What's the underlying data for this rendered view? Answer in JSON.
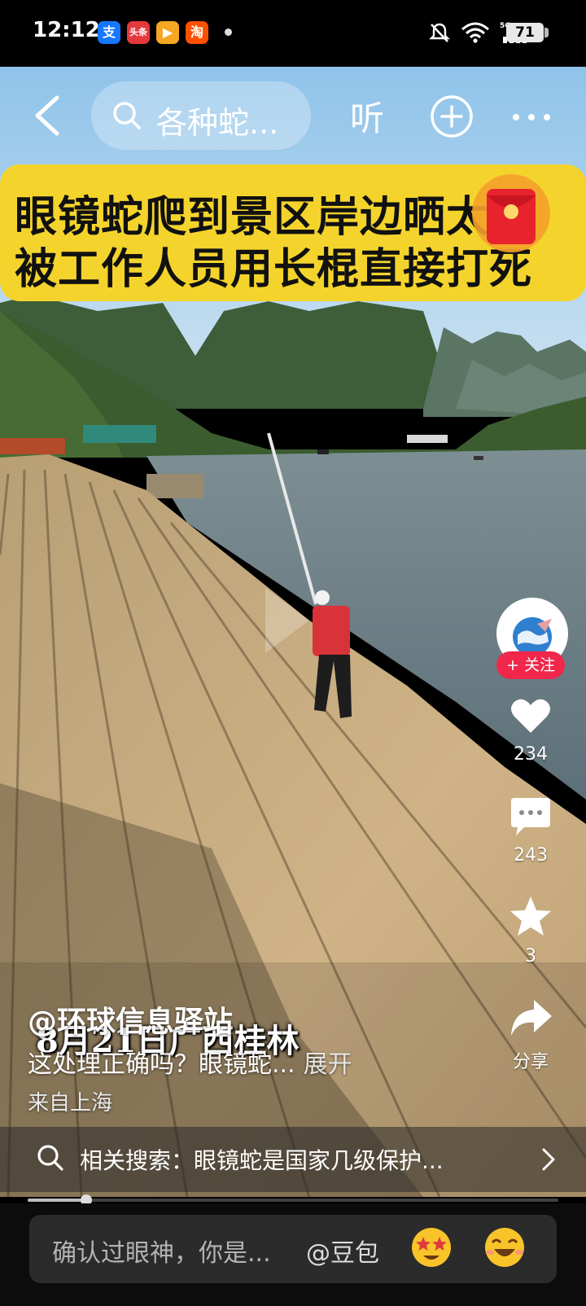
{
  "status_bar": {
    "time": "12:12",
    "app_icons": [
      {
        "name": "alipay-icon",
        "glyph": "支",
        "color": "#1677ff"
      },
      {
        "name": "toutiao-icon",
        "glyph": "头条",
        "color": "#e4393c"
      },
      {
        "name": "video-icon",
        "glyph": "▶",
        "color": "#f5a623"
      },
      {
        "name": "taobao-icon",
        "glyph": "淘",
        "color": "#ff5000"
      }
    ],
    "network": "5G",
    "battery": "71"
  },
  "top_bar": {
    "search_text": "各种蛇...",
    "listen_label": "听"
  },
  "banner": {
    "line1": "眼镜蛇爬到景区岸边晒太阳",
    "line2": "被工作人员用长棍直接打死"
  },
  "actions": {
    "follow_label": "+ 关注",
    "likes": "234",
    "comments": "243",
    "favorites": "3",
    "share_label": "分享"
  },
  "post": {
    "author": "@环球信息驿站",
    "burned_subtitle": "8月21日广西桂林",
    "description": "这处理正确吗？眼镜蛇...",
    "expand_label": "展开",
    "location": "来自上海"
  },
  "related_search": {
    "text": "相关搜索：眼镜蛇是国家几级保护..."
  },
  "progress": {
    "fraction": 0.11
  },
  "comment_bar": {
    "placeholder": "确认过眼神，你是...",
    "mention": "@豆包"
  },
  "colors": {
    "banner": "#f4d42c",
    "follow": "#f0274b"
  }
}
